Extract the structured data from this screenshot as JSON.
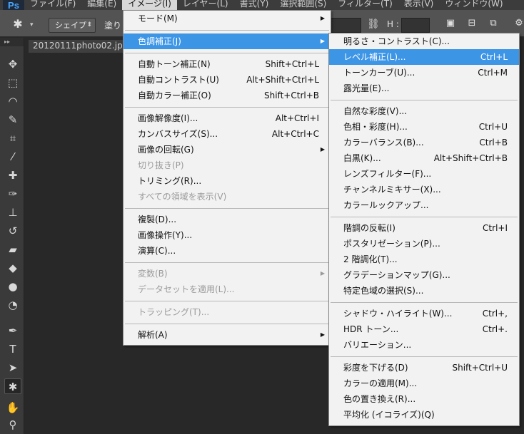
{
  "menubar": {
    "logo": "Ps",
    "items": [
      "ファイル(F)",
      "編集(E)",
      "イメージ(I)",
      "レイヤー(L)",
      "書式(Y)",
      "選択範囲(S)",
      "フィルター(T)",
      "表示(V)",
      "ウィンドウ(W)"
    ]
  },
  "options": {
    "tool_icon": "custom-shape-tool",
    "mode_select": "シェイプ",
    "fill_label": "塗り",
    "h_label": "H :"
  },
  "document": {
    "tab_title": "20120111photo02.jpg"
  },
  "image_menu": {
    "items": [
      {
        "label": "モード(M)",
        "shortcut": "",
        "submenu": true,
        "disabled": false
      },
      {
        "sep": true
      },
      {
        "label": "色調補正(J)",
        "shortcut": "",
        "submenu": true,
        "disabled": false,
        "highlight": true
      },
      {
        "sep": true
      },
      {
        "label": "自動トーン補正(N)",
        "shortcut": "Shift+Ctrl+L"
      },
      {
        "label": "自動コントラスト(U)",
        "shortcut": "Alt+Shift+Ctrl+L"
      },
      {
        "label": "自動カラー補正(O)",
        "shortcut": "Shift+Ctrl+B"
      },
      {
        "sep": true
      },
      {
        "label": "画像解像度(I)...",
        "shortcut": "Alt+Ctrl+I"
      },
      {
        "label": "カンバスサイズ(S)...",
        "shortcut": "Alt+Ctrl+C"
      },
      {
        "label": "画像の回転(G)",
        "shortcut": "",
        "submenu": true
      },
      {
        "label": "切り抜き(P)",
        "shortcut": "",
        "disabled": true
      },
      {
        "label": "トリミング(R)...",
        "shortcut": ""
      },
      {
        "label": "すべての領域を表示(V)",
        "shortcut": "",
        "disabled": true
      },
      {
        "sep": true
      },
      {
        "label": "複製(D)...",
        "shortcut": ""
      },
      {
        "label": "画像操作(Y)...",
        "shortcut": ""
      },
      {
        "label": "演算(C)...",
        "shortcut": ""
      },
      {
        "sep": true
      },
      {
        "label": "変数(B)",
        "shortcut": "",
        "submenu": true,
        "disabled": true
      },
      {
        "label": "データセットを適用(L)...",
        "shortcut": "",
        "disabled": true
      },
      {
        "sep": true
      },
      {
        "label": "トラッピング(T)...",
        "shortcut": "",
        "disabled": true
      },
      {
        "sep": true
      },
      {
        "label": "解析(A)",
        "shortcut": "",
        "submenu": true
      }
    ]
  },
  "adjust_menu": {
    "items": [
      {
        "label": "明るさ・コントラスト(C)...",
        "shortcut": ""
      },
      {
        "label": "レベル補正(L)...",
        "shortcut": "Ctrl+L",
        "highlight": true
      },
      {
        "label": "トーンカーブ(U)...",
        "shortcut": "Ctrl+M"
      },
      {
        "label": "露光量(E)...",
        "shortcut": ""
      },
      {
        "sep": true
      },
      {
        "label": "自然な彩度(V)...",
        "shortcut": ""
      },
      {
        "label": "色相・彩度(H)...",
        "shortcut": "Ctrl+U"
      },
      {
        "label": "カラーバランス(B)...",
        "shortcut": "Ctrl+B"
      },
      {
        "label": "白黒(K)...",
        "shortcut": "Alt+Shift+Ctrl+B"
      },
      {
        "label": "レンズフィルター(F)...",
        "shortcut": ""
      },
      {
        "label": "チャンネルミキサー(X)...",
        "shortcut": ""
      },
      {
        "label": "カラールックアップ...",
        "shortcut": ""
      },
      {
        "sep": true
      },
      {
        "label": "階調の反転(I)",
        "shortcut": "Ctrl+I"
      },
      {
        "label": "ポスタリゼーション(P)...",
        "shortcut": ""
      },
      {
        "label": "2 階調化(T)...",
        "shortcut": ""
      },
      {
        "label": "グラデーションマップ(G)...",
        "shortcut": ""
      },
      {
        "label": "特定色域の選択(S)...",
        "shortcut": ""
      },
      {
        "sep": true
      },
      {
        "label": "シャドウ・ハイライト(W)...",
        "shortcut": "Ctrl+,"
      },
      {
        "label": "HDR トーン...",
        "shortcut": "Ctrl+."
      },
      {
        "label": "バリエーション...",
        "shortcut": ""
      },
      {
        "sep": true
      },
      {
        "label": "彩度を下げる(D)",
        "shortcut": "Shift+Ctrl+U"
      },
      {
        "label": "カラーの適用(M)...",
        "shortcut": ""
      },
      {
        "label": "色の置き換え(R)...",
        "shortcut": ""
      },
      {
        "label": "平均化 (イコライズ)(Q)",
        "shortcut": ""
      }
    ]
  },
  "tools": [
    "move-icon",
    "marquee-icon",
    "lasso-icon",
    "quick-select-icon",
    "crop-icon",
    "eyedropper-icon",
    "healing-icon",
    "brush-icon",
    "stamp-icon",
    "history-brush-icon",
    "eraser-icon",
    "bucket-icon",
    "blur-icon",
    "dodge-icon",
    "pen-icon",
    "type-icon",
    "path-select-icon",
    "custom-shape-icon",
    "hand-icon",
    "zoom-icon"
  ],
  "colors": {
    "highlight": "#3d95e6",
    "menu_bg": "#f2f2f2"
  }
}
